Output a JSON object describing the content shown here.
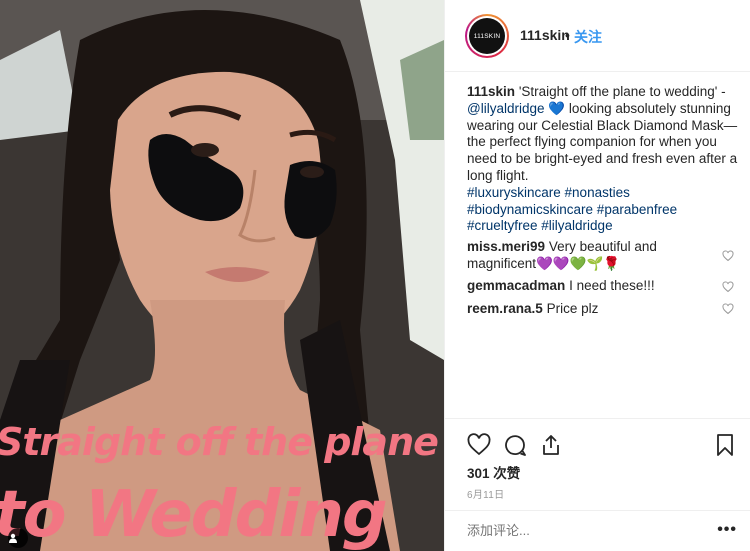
{
  "photo": {
    "overlay_line1": "Straight off the plane",
    "overlay_line2": "to Wedding",
    "tag_icon": "user-tag-icon"
  },
  "header": {
    "username": "111skin",
    "avatar_text": "111SKIN",
    "separator": "•",
    "follow_label": "关注"
  },
  "caption": {
    "username": "111skin",
    "text1": "'Straight off the plane to wedding' - ",
    "mention": "@lilyaldridge",
    "emoji": "💙",
    "text2": " looking absolutely stunning wearing our Celestial Black Diamond Mask—the perfect flying companion for when you need to be bright-eyed and fresh even after a long flight.",
    "hashtags_line1": "#luxuryskincare #nonasties",
    "hashtags_line2": "#biodynamicskincare #parabenfree",
    "hashtags_line3": "#crueltyfree #lilyaldridge"
  },
  "comments": [
    {
      "username": "miss.meri99",
      "text": "Very beautiful and magnificent💜💜💚🌱🌹"
    },
    {
      "username": "gemmacadman",
      "text": "I need these!!!"
    },
    {
      "username": "reem.rana.5",
      "text": "Price plz"
    }
  ],
  "actions": {
    "like_icon": "heart-icon",
    "comment_icon": "comment-icon",
    "share_icon": "share-icon",
    "save_icon": "bookmark-icon"
  },
  "likes": "301 次赞",
  "date": "6月11日",
  "comment_box": {
    "placeholder": "添加评论...",
    "more_label": "•••"
  },
  "colors": {
    "link": "#003569",
    "follow": "#3897f0",
    "overlay_text": "#f27683"
  }
}
